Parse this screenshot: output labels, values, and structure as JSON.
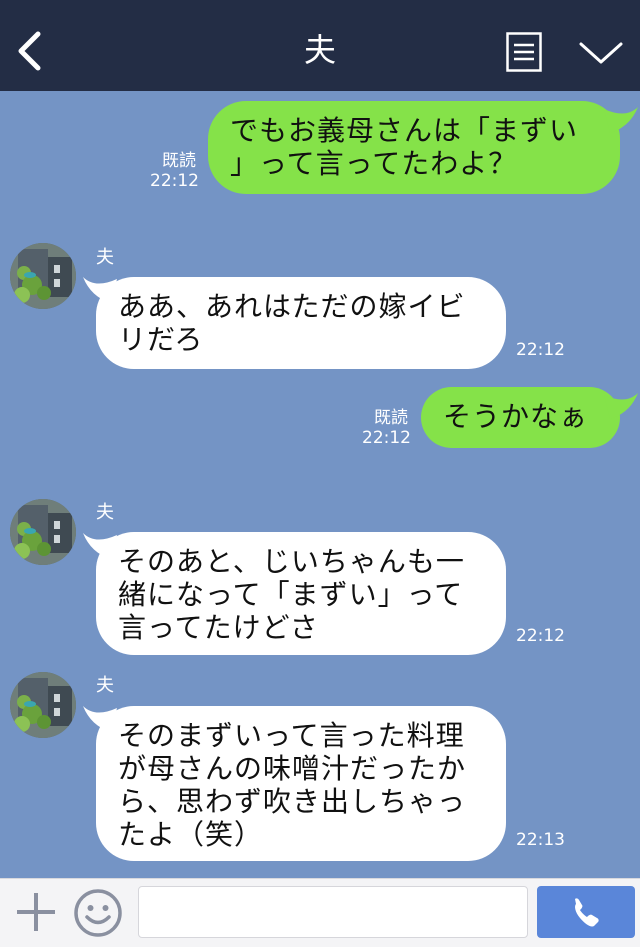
{
  "header": {
    "title": "夫",
    "icons": {
      "back": "chevron-left-icon",
      "menu": "notes-icon",
      "more": "chevron-down-icon"
    }
  },
  "messages": [
    {
      "side": "out",
      "lines": [
        "でもお義母さんは「まずい",
        "」って言ってたわよ？"
      ],
      "read": "既読",
      "time": "22:12"
    },
    {
      "side": "in",
      "sender": "夫",
      "lines": [
        "ああ、あれはただの嫁イビ",
        "リだろ"
      ],
      "time": "22:12"
    },
    {
      "side": "out",
      "lines": [
        "そうかなぁ"
      ],
      "read": "既読",
      "time": "22:12"
    },
    {
      "side": "in",
      "sender": "夫",
      "lines": [
        "そのあと、じいちゃんも一",
        "緒になって「まずい」って",
        "言ってたけどさ"
      ],
      "time": "22:12"
    },
    {
      "side": "in",
      "sender": "夫",
      "lines": [
        "そのまずいって言った料理",
        "が母さんの味噌汁だったか",
        "ら、思わず吹き出しちゃっ",
        "たよ（笑）"
      ],
      "time": "22:13"
    }
  ],
  "footer": {
    "input_value": "",
    "icons": {
      "plus": "plus-icon",
      "sticker": "smiley-icon",
      "call": "phone-icon"
    }
  },
  "colors": {
    "header": "#232d45",
    "background": "#7494c5",
    "outgoing_bubble": "#85e249",
    "incoming_bubble": "#ffffff",
    "call_button": "#5a86d9"
  }
}
